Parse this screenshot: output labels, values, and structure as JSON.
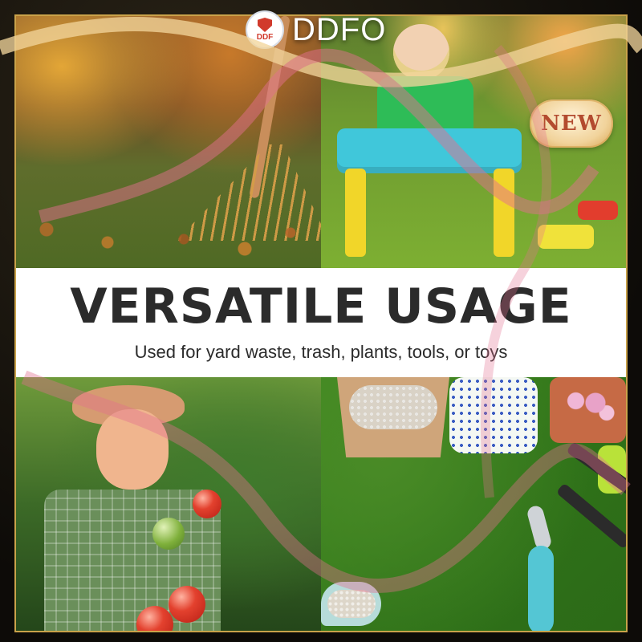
{
  "brand": {
    "logo_text": "DDF",
    "name": "DDFO"
  },
  "badge": {
    "text": "NEW"
  },
  "banner": {
    "title": "VERSATILE USAGE",
    "subtitle": "Used for yard waste, trash, plants, tools, or toys"
  },
  "colors": {
    "frame_gold": "#c9a24a",
    "banner_bg": "#ffffff",
    "title_text": "#2b2b2b",
    "badge_text": "#b34b2f",
    "ribbon_pink": "#e26f8e"
  },
  "photos": [
    {
      "name": "yard-waste-photo"
    },
    {
      "name": "toys-photo"
    },
    {
      "name": "plants-photo"
    },
    {
      "name": "tools-photo"
    }
  ]
}
